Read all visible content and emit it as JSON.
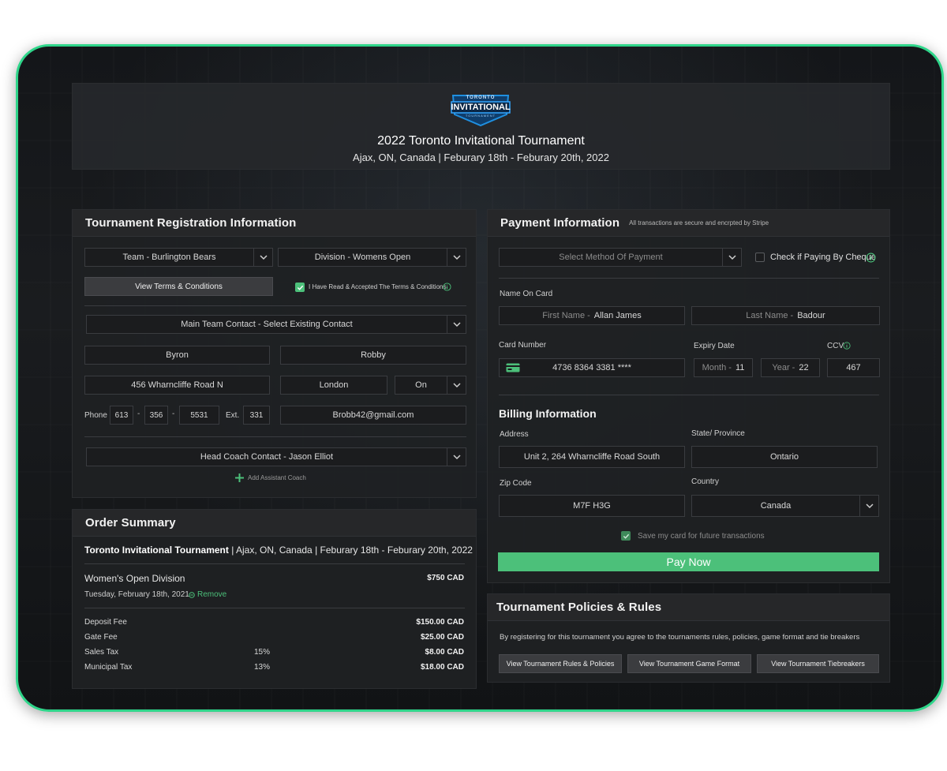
{
  "header": {
    "logo_top": "TORONTO",
    "logo_main": "INVITATIONAL",
    "logo_bottom": "TOURNAMENT",
    "title": "2022 Toronto Invitational Tournament",
    "subtitle": "Ajax, ON, Canada | Feburary 18th - Feburary 20th, 2022"
  },
  "registration": {
    "title": "Tournament Registration Information",
    "team_select": "Team - Burlington Bears",
    "division_select": "Division - Womens Open",
    "terms_button": "View Terms & Conditions",
    "terms_check_label": "I Have Read & Accepted The Terms & Conditions",
    "main_contact_select": "Main Team Contact - Select Existing Contact",
    "first_name": "Byron",
    "last_name": "Robby",
    "address": "456 Wharncliffe Road N",
    "city": "London",
    "province": "On",
    "phone_label": "Phone",
    "phone_area": "613",
    "phone_prefix": "356",
    "phone_line": "5531",
    "ext_label": "Ext.",
    "ext": "331",
    "email": "Brobb42@gmail.com",
    "head_coach_select": "Head Coach Contact - Jason Elliot",
    "add_assistant": "Add Assistant Coach",
    "dash": "-"
  },
  "order": {
    "title": "Order Summary",
    "event_name": "Toronto Invitational Tournament",
    "event_details": " | Ajax, ON, Canada | Feburary 18th - Feburary 20th, 2022",
    "division": "Women's Open Division",
    "division_price": "$750 CAD",
    "date": "Tuesday, February 18th, 2021",
    "remove": "Remove",
    "fees": [
      {
        "label": "Deposit Fee",
        "pct": "",
        "amount": "$150.00 CAD"
      },
      {
        "label": "Gate Fee",
        "pct": "",
        "amount": "$25.00 CAD"
      },
      {
        "label": "Sales Tax",
        "pct": "15%",
        "amount": "$8.00 CAD"
      },
      {
        "label": "Municipal Tax",
        "pct": "13%",
        "amount": "$18.00 CAD"
      }
    ]
  },
  "payment": {
    "title": "Payment Information",
    "secure_note": "All transactions are secure and encrpted by Stripe",
    "method_placeholder": "Select Method Of Payment",
    "cheque_label": "Check if Paying By Cheque",
    "name_on_card_label": "Name On Card",
    "first_name_ph": "First Name -",
    "first_name": "Allan James",
    "last_name_ph": "Last Name -",
    "last_name": "Badour",
    "card_number_label": "Card Number",
    "card_number": "4736 8364 3381 ****",
    "expiry_label": "Expiry Date",
    "month_ph": "Month -",
    "month": "11",
    "year_ph": "Year -",
    "year": "22",
    "ccv_label": "CCV",
    "ccv": "467",
    "billing_title": "Billing Information",
    "address_label": "Address",
    "address": "Unit 2, 264 Wharncliffe Road South",
    "state_label": "State/ Province",
    "state": "Ontario",
    "zip_label": "Zip Code",
    "zip": "M7F H3G",
    "country_label": "Country",
    "country": "Canada",
    "save_card_label": "Save my card for future transactions",
    "pay_button": "Pay Now"
  },
  "policies": {
    "title": "Tournament Policies & Rules",
    "text": "By registering for this tournament you agree to the tournaments rules, policies, game format and tie breakers",
    "btn_rules": "View Tournament Rules & Policies",
    "btn_format": "View Tournament Game Format",
    "btn_tiebreakers": "View Tournament Tiebreakers"
  },
  "colors": {
    "accent_green": "#4cc07a",
    "frame_border": "#2fd58a",
    "logo_blue": "#1f8fe0"
  }
}
